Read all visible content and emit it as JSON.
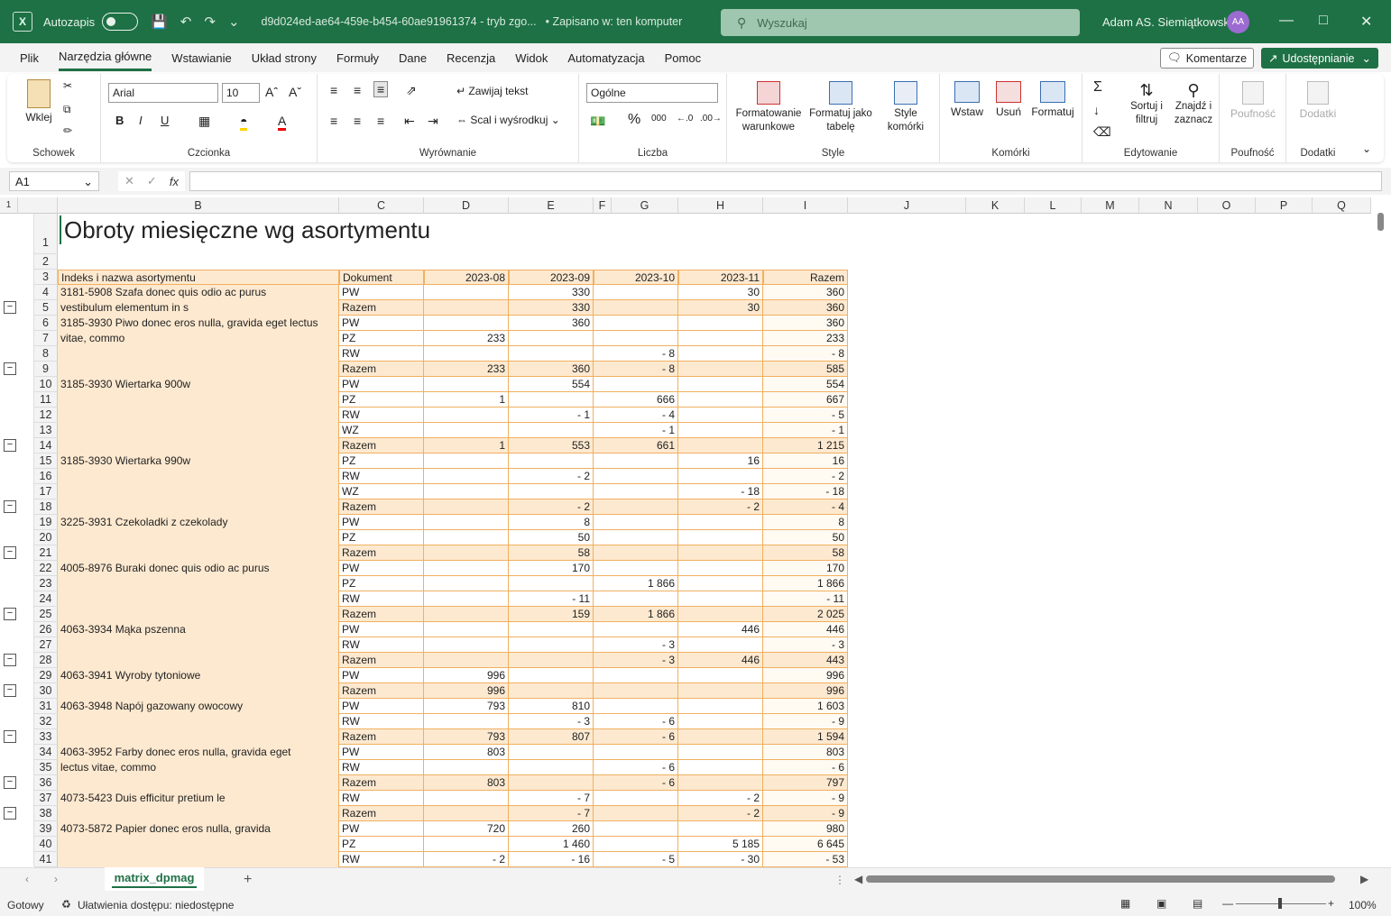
{
  "titlebar": {
    "autosave_label": "Autozapis",
    "filename": "d9d024ed-ae64-459e-b454-60ae91961374 - tryb zgo...",
    "saved_status": "• Zapisano w: ten komputer",
    "search_placeholder": "Wyszukaj",
    "user_name": "Adam AS. Siemiątkowski",
    "user_initials": "AA"
  },
  "menu": {
    "tabs": [
      "Plik",
      "Narzędzia główne",
      "Wstawianie",
      "Układ strony",
      "Formuły",
      "Dane",
      "Recenzja",
      "Widok",
      "Automatyzacja",
      "Pomoc"
    ],
    "active_tab": "Narzędzia główne",
    "comments_label": "Komentarze",
    "share_label": "Udostępnianie"
  },
  "ribbon": {
    "clipboard": {
      "paste": "Wklej",
      "group": "Schowek"
    },
    "font": {
      "name": "Arial",
      "size": "10",
      "group": "Czcionka"
    },
    "alignment": {
      "wrap": "Zawijaj tekst",
      "merge": "Scal i wyśrodkuj",
      "group": "Wyrównanie"
    },
    "number": {
      "format": "Ogólne",
      "group": "Liczba"
    },
    "styles": {
      "conditional": "Formatowanie warunkowe",
      "table": "Formatuj jako tabelę",
      "cell_styles": "Style komórki",
      "group": "Style"
    },
    "cells": {
      "insert": "Wstaw",
      "delete": "Usuń",
      "format": "Formatuj",
      "group": "Komórki"
    },
    "editing": {
      "sort": "Sortuj i filtruj",
      "find": "Znajdź i zaznacz",
      "group": "Edytowanie"
    },
    "sensitivity": {
      "label": "Poufność",
      "group": "Poufność"
    },
    "addins": {
      "label": "Dodatki",
      "group": "Dodatki"
    }
  },
  "formula_bar": {
    "name_box": "A1",
    "fx": "fx",
    "formula": ""
  },
  "columns": [
    "B",
    "C",
    "D",
    "E",
    "F",
    "G",
    "H",
    "I",
    "J",
    "K",
    "L",
    "M",
    "N",
    "O",
    "P",
    "Q"
  ],
  "sheet": {
    "title": "Obroty miesięczne wg asortymentu",
    "headers": [
      "Indeks i nazwa asortymentu",
      "Dokument",
      "2023-08",
      "2023-09",
      "2023-10",
      "2023-11",
      "Razem"
    ],
    "rows": [
      {
        "r": "4",
        "item": "3181-5908 Szafa donec quis odio ac purus",
        "doc": "PW",
        "v": [
          "",
          "330",
          "",
          "30",
          "360"
        ]
      },
      {
        "r": "5",
        "item": "vestibulum elementum in s",
        "doc": "Razem",
        "v": [
          "",
          "330",
          "",
          "30",
          "360"
        ]
      },
      {
        "r": "6",
        "item": "3185-3930 Piwo donec eros nulla, gravida eget lectus",
        "doc": "PW",
        "v": [
          "",
          "360",
          "",
          "",
          "360"
        ]
      },
      {
        "r": "7",
        "item": "vitae, commo",
        "doc": "PZ",
        "v": [
          "233",
          "",
          "",
          "",
          "233"
        ]
      },
      {
        "r": "8",
        "item": "",
        "doc": "RW",
        "v": [
          "",
          "",
          "- 8",
          "",
          "- 8"
        ]
      },
      {
        "r": "9",
        "item": "",
        "doc": "Razem",
        "v": [
          "233",
          "360",
          "- 8",
          "",
          "585"
        ]
      },
      {
        "r": "10",
        "item": "3185-3930 Wiertarka 900w",
        "doc": "PW",
        "v": [
          "",
          "554",
          "",
          "",
          "554"
        ]
      },
      {
        "r": "11",
        "item": "",
        "doc": "PZ",
        "v": [
          "1",
          "",
          "666",
          "",
          "667"
        ]
      },
      {
        "r": "12",
        "item": "",
        "doc": "RW",
        "v": [
          "",
          "- 1",
          "- 4",
          "",
          "- 5"
        ]
      },
      {
        "r": "13",
        "item": "",
        "doc": "WZ",
        "v": [
          "",
          "",
          "- 1",
          "",
          "- 1"
        ]
      },
      {
        "r": "14",
        "item": "",
        "doc": "Razem",
        "v": [
          "1",
          "553",
          "661",
          "",
          "1 215"
        ]
      },
      {
        "r": "15",
        "item": "3185-3930 Wiertarka 990w",
        "doc": "PZ",
        "v": [
          "",
          "",
          "",
          "16",
          "16"
        ]
      },
      {
        "r": "16",
        "item": "",
        "doc": "RW",
        "v": [
          "",
          "- 2",
          "",
          "",
          "- 2"
        ]
      },
      {
        "r": "17",
        "item": "",
        "doc": "WZ",
        "v": [
          "",
          "",
          "",
          "- 18",
          "- 18"
        ]
      },
      {
        "r": "18",
        "item": "",
        "doc": "Razem",
        "v": [
          "",
          "- 2",
          "",
          "- 2",
          "- 4"
        ]
      },
      {
        "r": "19",
        "item": "3225-3931 Czekoladki z czekolady",
        "doc": "PW",
        "v": [
          "",
          "8",
          "",
          "",
          "8"
        ]
      },
      {
        "r": "20",
        "item": "",
        "doc": "PZ",
        "v": [
          "",
          "50",
          "",
          "",
          "50"
        ]
      },
      {
        "r": "21",
        "item": "",
        "doc": "Razem",
        "v": [
          "",
          "58",
          "",
          "",
          "58"
        ]
      },
      {
        "r": "22",
        "item": "4005-8976 Buraki donec quis odio ac purus",
        "doc": "PW",
        "v": [
          "",
          "170",
          "",
          "",
          "170"
        ]
      },
      {
        "r": "23",
        "item": "",
        "doc": "PZ",
        "v": [
          "",
          "",
          "1 866",
          "",
          "1 866"
        ]
      },
      {
        "r": "24",
        "item": "",
        "doc": "RW",
        "v": [
          "",
          "- 11",
          "",
          "",
          "- 11"
        ]
      },
      {
        "r": "25",
        "item": "",
        "doc": "Razem",
        "v": [
          "",
          "159",
          "1 866",
          "",
          "2 025"
        ]
      },
      {
        "r": "26",
        "item": "4063-3934 Mąka pszenna",
        "doc": "PW",
        "v": [
          "",
          "",
          "",
          "446",
          "446"
        ]
      },
      {
        "r": "27",
        "item": "",
        "doc": "RW",
        "v": [
          "",
          "",
          "- 3",
          "",
          "- 3"
        ]
      },
      {
        "r": "28",
        "item": "",
        "doc": "Razem",
        "v": [
          "",
          "",
          "- 3",
          "446",
          "443"
        ]
      },
      {
        "r": "29",
        "item": "4063-3941 Wyroby tytoniowe",
        "doc": "PW",
        "v": [
          "996",
          "",
          "",
          "",
          "996"
        ]
      },
      {
        "r": "30",
        "item": "",
        "doc": "Razem",
        "v": [
          "996",
          "",
          "",
          "",
          "996"
        ]
      },
      {
        "r": "31",
        "item": "4063-3948 Napój gazowany owocowy",
        "doc": "PW",
        "v": [
          "793",
          "810",
          "",
          "",
          "1 603"
        ]
      },
      {
        "r": "32",
        "item": "",
        "doc": "RW",
        "v": [
          "",
          "- 3",
          "- 6",
          "",
          "- 9"
        ]
      },
      {
        "r": "33",
        "item": "",
        "doc": "Razem",
        "v": [
          "793",
          "807",
          "- 6",
          "",
          "1 594"
        ]
      },
      {
        "r": "34",
        "item": "4063-3952 Farby donec eros nulla, gravida eget",
        "doc": "PW",
        "v": [
          "803",
          "",
          "",
          "",
          "803"
        ]
      },
      {
        "r": "35",
        "item": "lectus vitae, commo",
        "doc": "RW",
        "v": [
          "",
          "",
          "- 6",
          "",
          "- 6"
        ]
      },
      {
        "r": "36",
        "item": "",
        "doc": "Razem",
        "v": [
          "803",
          "",
          "- 6",
          "",
          "797"
        ]
      },
      {
        "r": "37",
        "item": "4073-5423 Duis efficitur pretium le",
        "doc": "RW",
        "v": [
          "",
          "- 7",
          "",
          "- 2",
          "- 9"
        ]
      },
      {
        "r": "38",
        "item": "",
        "doc": "Razem",
        "v": [
          "",
          "- 7",
          "",
          "- 2",
          "- 9"
        ]
      },
      {
        "r": "39",
        "item": "4073-5872 Papier donec eros nulla, gravida",
        "doc": "PW",
        "v": [
          "720",
          "260",
          "",
          "",
          "980"
        ]
      },
      {
        "r": "40",
        "item": "",
        "doc": "PZ",
        "v": [
          "",
          "1 460",
          "",
          "5 185",
          "6 645"
        ]
      },
      {
        "r": "41",
        "item": "",
        "doc": "RW",
        "v": [
          "- 2",
          "- 16",
          "- 5",
          "- 30",
          "- 53"
        ]
      }
    ]
  },
  "tabs": {
    "sheet_name": "matrix_dpmag",
    "add": "+"
  },
  "status": {
    "ready": "Gotowy",
    "accessibility": "Ułatwienia dostępu: niedostępne",
    "zoom": "100%"
  },
  "colors": {
    "brand": "#1e7145",
    "item_fill": "#fde9d0",
    "total_fill": "#fde9d0",
    "row_fill": "#fffaf2"
  }
}
